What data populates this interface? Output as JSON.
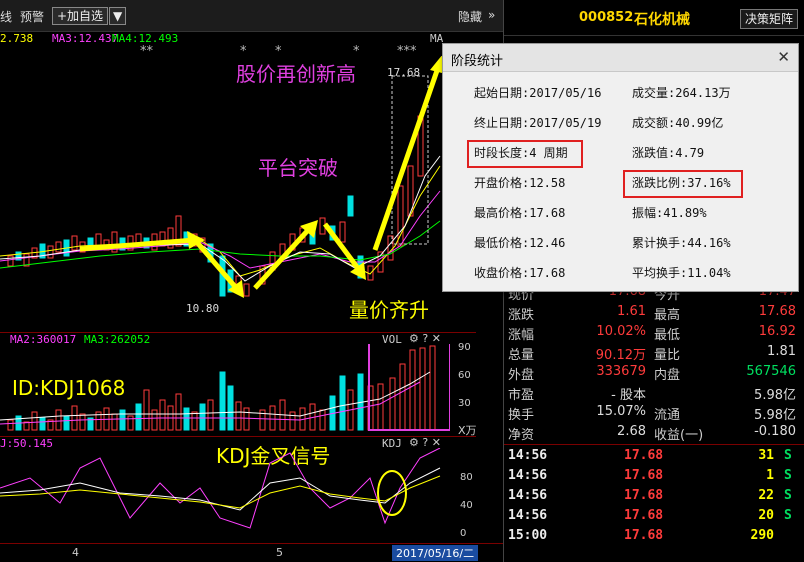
{
  "toolbar": {
    "left_cut": "线",
    "alert": "预警",
    "add_btn": "+加自选",
    "dropdown": "▼",
    "hide": "隐藏",
    "chev": "»"
  },
  "ma_line": {
    "ma_cut": "2.738",
    "ma3": "MA3:12.437",
    "ma4": "MA4:12.493",
    "ma_tail": "MA"
  },
  "stars": {
    "s1": "**",
    "s2": "*",
    "s3": "*",
    "s4": "*",
    "s5": "***"
  },
  "price_labels": {
    "high": "17.68",
    "low": "10.80"
  },
  "annotations": {
    "a1": "股价再创新高",
    "a2": "平台突破",
    "a3": "量价齐升",
    "a4": "ID:KDJ1068",
    "a5": "KDJ金叉信号"
  },
  "volume_pane": {
    "ma2": "MA2:360017",
    "ma3": "MA3:262052",
    "title": "VOL",
    "unit": "X万",
    "ticks": [
      "90",
      "60",
      "30"
    ]
  },
  "kdj_pane": {
    "label": "J:50.145",
    "title": "KDJ",
    "ticks": [
      "80",
      "40",
      "0"
    ]
  },
  "bottom_axis": {
    "t1": "4",
    "t2": "5",
    "date": "2017/05/16/二"
  },
  "header": {
    "code": "000852",
    "name": "石化机械",
    "button": "决策矩阵"
  },
  "dialog": {
    "title": "阶段统计",
    "close": "✕",
    "rows": [
      {
        "l": "起始日期:2017/05/16",
        "r": "成交量:264.13万"
      },
      {
        "l": "终止日期:2017/05/19",
        "r": "成交额:40.99亿"
      },
      {
        "l": "时段长度:4 周期",
        "r": "涨跌值:4.79"
      },
      {
        "l": "开盘价格:12.58",
        "r": "涨跌比例:37.16%"
      },
      {
        "l": "最高价格:17.68",
        "r": "振幅:41.89%"
      },
      {
        "l": "最低价格:12.46",
        "r": "累计换手:44.16%"
      },
      {
        "l": "收盘价格:17.68",
        "r": "平均换手:11.04%"
      }
    ]
  },
  "quote": {
    "rows": [
      {
        "k1": "现价",
        "v1": "17.68",
        "k2": "今开",
        "v2": "17.47"
      },
      {
        "k1": "涨跌",
        "v1": "1.61",
        "k2": "最高",
        "v2": "17.68"
      },
      {
        "k1": "涨幅",
        "v1": "10.02%",
        "k2": "最低",
        "v2": "16.92"
      },
      {
        "k1": "总量",
        "v1": "90.12万",
        "k2": "量比",
        "v2": "1.81"
      },
      {
        "k1": "外盘",
        "v1": "333679",
        "k2": "内盘",
        "v2": "567546"
      },
      {
        "k1": "市盈",
        "v1": "- 股本",
        "k2": "",
        "v2": "5.98亿"
      },
      {
        "k1": "换手",
        "v1": "15.07%",
        "k2": "流通",
        "v2": "5.98亿"
      },
      {
        "k1": "净资",
        "v1": "2.68",
        "k2": "收益(一)",
        "v2": "-0.180"
      }
    ]
  },
  "trades": [
    {
      "t": "14:56",
      "p": "17.68",
      "v": "31",
      "s": "S"
    },
    {
      "t": "14:56",
      "p": "17.68",
      "v": "1",
      "s": "S"
    },
    {
      "t": "14:56",
      "p": "17.68",
      "v": "22",
      "s": "S"
    },
    {
      "t": "14:56",
      "p": "17.68",
      "v": "20",
      "s": "S"
    },
    {
      "t": "15:00",
      "p": "17.68",
      "v": "290",
      "s": ""
    }
  ],
  "colors": {
    "up": "#ff3b3b",
    "down": "#00e0e0",
    "ma_yellow": "#ffff00",
    "ma_magenta": "#ff40ff",
    "ma_green": "#00ff00",
    "annot_magenta": "#e040e0",
    "annot_yellow": "#ffff00"
  }
}
